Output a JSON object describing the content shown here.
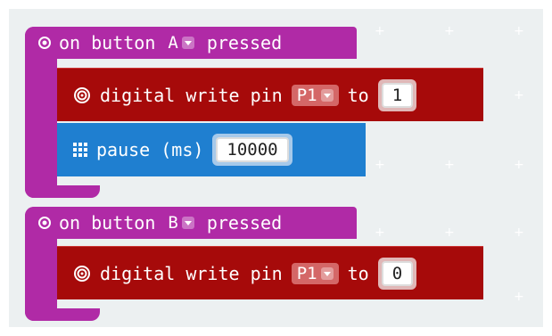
{
  "blocks": [
    {
      "event_label_prefix": "on button",
      "button_value": "A",
      "event_label_suffix": "pressed",
      "statements": [
        {
          "type": "digital-write",
          "label_prefix": "digital write pin",
          "pin": "P1",
          "label_to": "to",
          "value": "1"
        },
        {
          "type": "pause",
          "label": "pause (ms)",
          "value": "10000"
        }
      ]
    },
    {
      "event_label_prefix": "on button",
      "button_value": "B",
      "event_label_suffix": "pressed",
      "statements": [
        {
          "type": "digital-write",
          "label_prefix": "digital write pin",
          "pin": "P1",
          "label_to": "to",
          "value": "0"
        }
      ]
    }
  ],
  "colors": {
    "input_event": "#b02aa6",
    "pins": "#a60a0a",
    "basic": "#1f7fd0",
    "workspace": "#ecf0f1"
  },
  "icons": [
    "radio-button-icon",
    "target-icon",
    "grid-icon",
    "dropdown-caret-icon"
  ]
}
